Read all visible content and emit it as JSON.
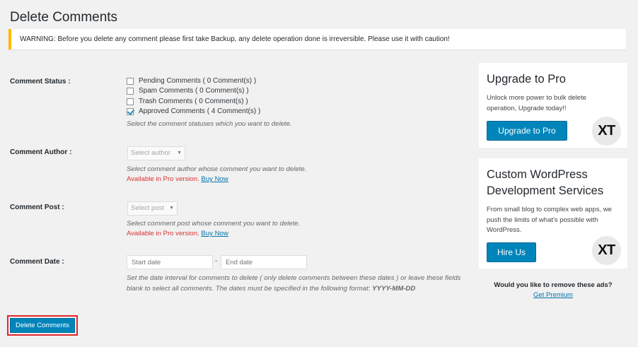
{
  "page_title": "Delete Comments",
  "warning": "WARNING: Before you delete any comment please first take Backup, any delete operation done is irreversible. Please use it with caution!",
  "status": {
    "label": "Comment Status :",
    "options": [
      {
        "label": "Pending Comments ( 0 Comment(s) )",
        "checked": false
      },
      {
        "label": "Spam Comments ( 0 Comment(s) )",
        "checked": false
      },
      {
        "label": "Trash Comments ( 0 Comment(s) )",
        "checked": false
      },
      {
        "label": "Approved Comments ( 4 Comment(s) )",
        "checked": true
      }
    ],
    "description": "Select the comment statuses which you want to delete."
  },
  "author": {
    "label": "Comment Author :",
    "select_value": "Select author",
    "description": "Select comment author whose comment you want to delete.",
    "pro_note": "Available in Pro version.",
    "buy_link": "Buy Now"
  },
  "post": {
    "label": "Comment Post :",
    "select_value": "Select post",
    "description": "Select comment post whose comment you want to delete.",
    "pro_note": "Available in Pro version.",
    "buy_link": "Buy Now"
  },
  "date": {
    "label": "Comment Date :",
    "start_placeholder": "Start date",
    "end_placeholder": "End date",
    "separator": "-",
    "description": "Set the date interval for comments to delete ( only delete comments between these dates ) or leave these fields blank to select all comments. The dates must be specified in the following format:",
    "format": "YYYY-MM-DD"
  },
  "delete_button": "Delete Comments",
  "upgrade_card": {
    "title": "Upgrade to Pro",
    "text": "Unlock more power to bulk delete operation, Upgrade today!!",
    "button": "Upgrade to Pro",
    "logo": "XT"
  },
  "services_card": {
    "title": "Custom WordPress Development Services",
    "text": "From small blog to complex web apps, we push the limits of what's possible with WordPress.",
    "button": "Hire Us",
    "logo": "XT"
  },
  "ads": {
    "question": "Would you like to remove these ads?",
    "link": "Get Premium"
  },
  "colors": {
    "primary": "#0085ba",
    "warning_border": "#ffb900",
    "pro_note": "#dc3232",
    "highlight": "#e0262f",
    "link": "#0073aa"
  }
}
